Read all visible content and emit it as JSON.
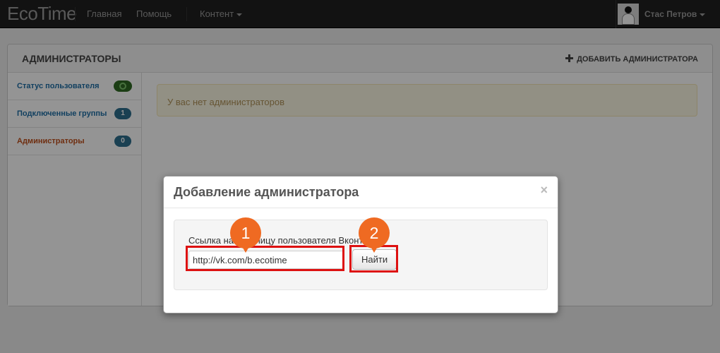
{
  "navbar": {
    "brand": "EcoTime",
    "links": [
      "Главная",
      "Помощь",
      "Контент"
    ],
    "user_name": "Стас Петров"
  },
  "panel": {
    "title": "АДМИНИСТРАТОРЫ",
    "add_admin": "ДОБАВИТЬ АДМИНИСТРАТОРА",
    "sidebar": [
      {
        "label": "Статус пользователя",
        "badge": ""
      },
      {
        "label": "Подключенные группы",
        "badge": "1"
      },
      {
        "label": "Администраторы",
        "badge": "0"
      }
    ],
    "alert": "У вас нет администраторов"
  },
  "modal": {
    "title": "Добавление администратора",
    "close": "×",
    "field_label": "Ссылка на страницу пользователя Вконтакте",
    "input_value": "http://vk.com/b.ecotime",
    "button": "Найти"
  },
  "callouts": [
    "1",
    "2"
  ],
  "colors": {
    "navbar": "#1f1f1f",
    "link": "#1f6fa5",
    "active": "#c0501c",
    "badge": "#2d6e8e",
    "callout": "#ef6a22",
    "highlight": "#dd1111"
  }
}
